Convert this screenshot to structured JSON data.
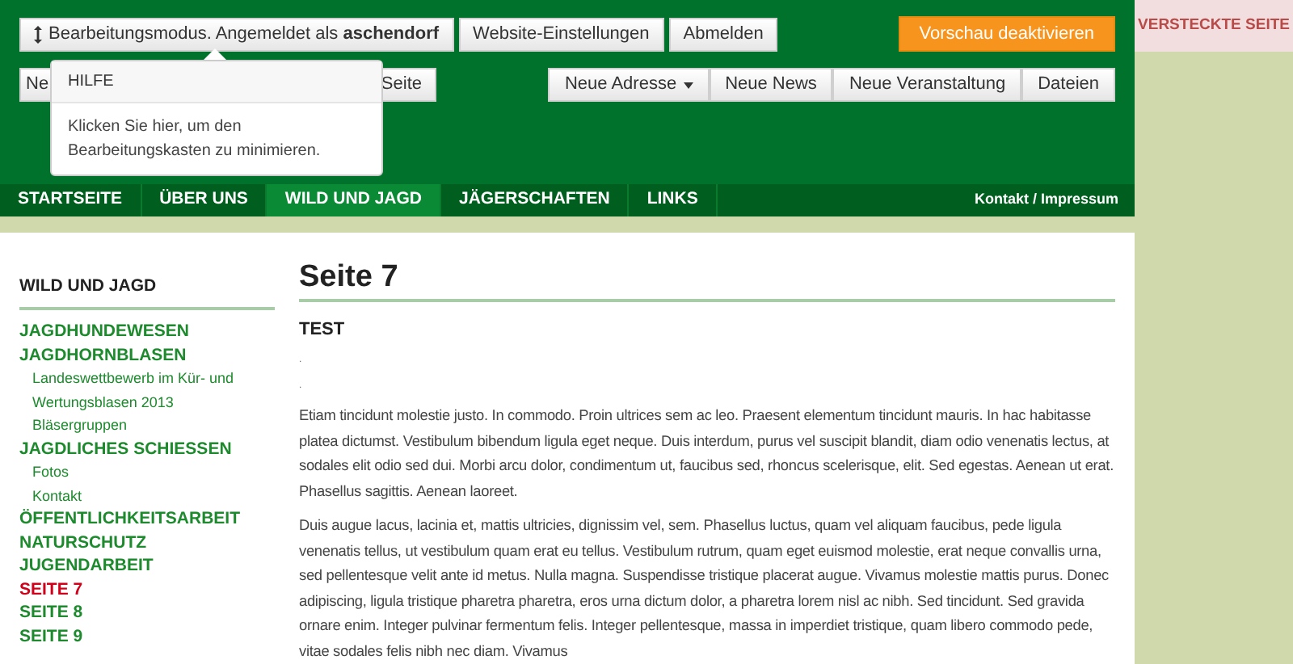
{
  "admin_bar": {
    "mode_button": {
      "text": "Bearbeitungsmodus. Angemeldet als **aschendorf**"
    },
    "buttons": [
      "Website-Einstellungen",
      "Abmelden"
    ],
    "preview_button": "Vorschau deaktivieren"
  },
  "hidden_badge": "VERSTECKTE SEITE",
  "edit_toolbar": {
    "left_buttons": [
      "Ne",
      "Seite"
    ],
    "right_buttons": [
      {
        "label": "Neue Adresse",
        "dropdown": true
      },
      {
        "label": "Neue News",
        "dropdown": false
      },
      {
        "label": "Neue Veranstaltung",
        "dropdown": false
      },
      {
        "label": "Dateien",
        "dropdown": false
      }
    ]
  },
  "tooltip": {
    "title": "HILFE",
    "text": "Klicken Sie hier, um den Bearbeitungskasten zu minimieren."
  },
  "nav": {
    "tabs": [
      {
        "label": "STARTSEITE",
        "selected": false
      },
      {
        "label": "ÜBER UNS",
        "selected": false
      },
      {
        "label": "WILD UND JAGD",
        "selected": true
      },
      {
        "label": "JÄGERSCHAFTEN",
        "selected": false
      },
      {
        "label": "LINKS",
        "selected": false
      }
    ],
    "meta_link": "Kontakt / Impressum"
  },
  "sidebar": {
    "title": "WILD UND JAGD",
    "items": [
      {
        "label": "JAGDHUNDEWESEN",
        "selected": false
      },
      {
        "label": "JAGDHORNBLASEN",
        "selected": false,
        "children": [
          {
            "label": "Landeswettbewerb im Kür- und Wertungsblasen 2013",
            "selected": false
          },
          {
            "label": "Bläsergruppen",
            "selected": false
          }
        ]
      },
      {
        "label": "JAGDLICHES SCHIESSEN",
        "selected": false,
        "children": [
          {
            "label": "Fotos",
            "selected": false
          },
          {
            "label": "Kontakt",
            "selected": false
          }
        ]
      },
      {
        "label": "ÖFFENTLICHKEITSARBEIT",
        "selected": false
      },
      {
        "label": "NATURSCHUTZ",
        "selected": false
      },
      {
        "label": "JUGENDARBEIT",
        "selected": false
      },
      {
        "label": "SEITE 7",
        "selected": true
      },
      {
        "label": "SEITE 8",
        "selected": false
      },
      {
        "label": "SEITE 9",
        "selected": false
      }
    ]
  },
  "content": {
    "title": "Seite 7",
    "subtitle": "TEST",
    "dots": [
      ".",
      "."
    ],
    "paragraphs": [
      "Etiam tincidunt molestie justo. In commodo. Proin ultrices sem ac leo. Praesent elementum tincidunt mauris. In hac habitasse platea dictumst. Vestibulum bibendum ligula eget neque. Duis interdum, purus vel suscipit blandit, diam odio venenatis lectus, at sodales elit odio sed dui. Morbi arcu dolor, condimentum ut, faucibus sed, rhoncus scelerisque, elit. Sed egestas. Aenean ut erat. Phasellus sagittis. Aenean laoreet.",
      "Duis augue lacus, lacinia et, mattis ultricies, dignissim vel, sem. Phasellus luctus, quam vel aliquam faucibus, pede ligula venenatis tellus, ut vestibulum quam erat eu tellus. Vestibulum rutrum, quam eget euismod molestie, erat neque convallis urna, sed pellentesque velit ante id metus. Nulla magna. Suspendisse tristique placerat augue. Vivamus molestie mattis purus. Donec adipiscing, ligula tristique pharetra pharetra, eros urna dictum dolor, a pharetra lorem nisl ac nibh. Sed tincidunt. Sed gravida ornare enim. Integer pulvinar fermentum felis. Integer pellentesque, massa in imperdiet tristique, quam libero commodo pede, vitae sodales felis nibh nec diam. Vivamus"
    ]
  }
}
